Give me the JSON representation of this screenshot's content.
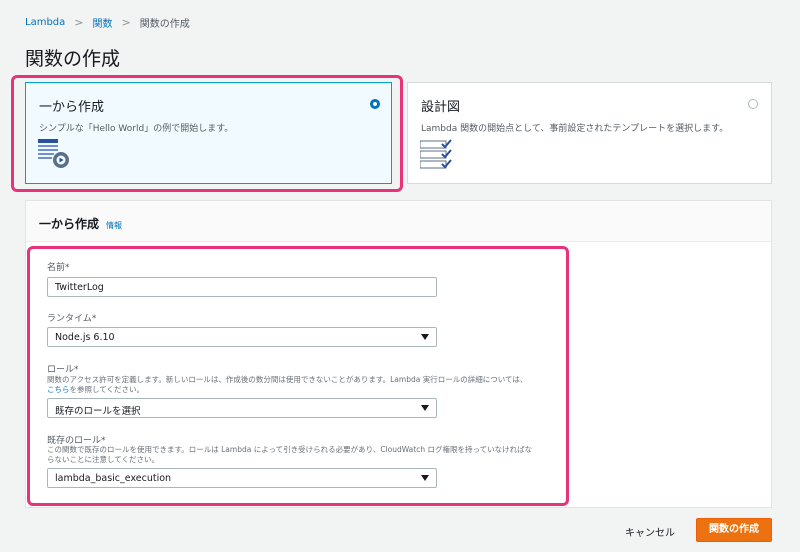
{
  "breadcrumb": {
    "item1": "Lambda",
    "item2": "関数",
    "current": "関数の作成"
  },
  "page_title": "関数の作成",
  "options": {
    "scratch": {
      "title": "一から作成",
      "desc": "シンプルな「Hello World」の例で開始します。",
      "selected": true
    },
    "blueprint": {
      "title": "設計図",
      "desc": "Lambda 関数の開始点として、事前設定されたテンプレートを選択します。",
      "selected": false
    }
  },
  "form": {
    "title": "一から作成",
    "info": "情報",
    "name": {
      "label": "名前*",
      "value": "TwitterLog"
    },
    "runtime": {
      "label": "ランタイム*",
      "value": "Node.js 6.10"
    },
    "role": {
      "label": "ロール*",
      "desc_line1": "関数のアクセス許可を定義します。新しいロールは、作成後の数分間は使用できないことがあります。Lambda 実行ロールの詳細については、",
      "desc_link": "こちら",
      "desc_line2_tail": "を参照してください。",
      "value": "既存のロールを選択"
    },
    "existing_role": {
      "label": "既存のロール*",
      "desc_line1": "この関数で既存のロールを使用できます。ロールは Lambda によって引き受けられる必要があり、CloudWatch ログ権限を持っていなければな",
      "desc_line2": "らないことに注意してください。",
      "value": "lambda_basic_execution"
    }
  },
  "footer": {
    "cancel": "キャンセル",
    "create": "関数の作成"
  },
  "colors": {
    "accent": "#0073bb",
    "primary_button": "#ec7211",
    "highlight": "#e7337a"
  }
}
